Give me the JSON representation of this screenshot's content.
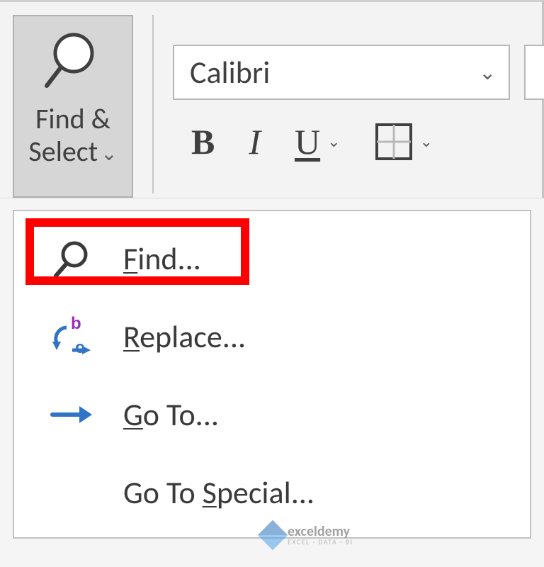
{
  "ribbon": {
    "find_select": {
      "line1": "Find &",
      "line2": "Select"
    },
    "font_name": "Calibri",
    "bold": "B",
    "italic": "I",
    "underline": "U"
  },
  "menu": {
    "find": "ind...",
    "find_ul": "F",
    "replace": "eplace...",
    "replace_ul": "R",
    "goto": "o To...",
    "goto_ul": "G",
    "goto_special_pre": "Go To ",
    "goto_special_ul": "S",
    "goto_special_post": "pecial..."
  },
  "watermark": {
    "brand": "exceldemy",
    "tag": "EXCEL · DATA · BI"
  }
}
